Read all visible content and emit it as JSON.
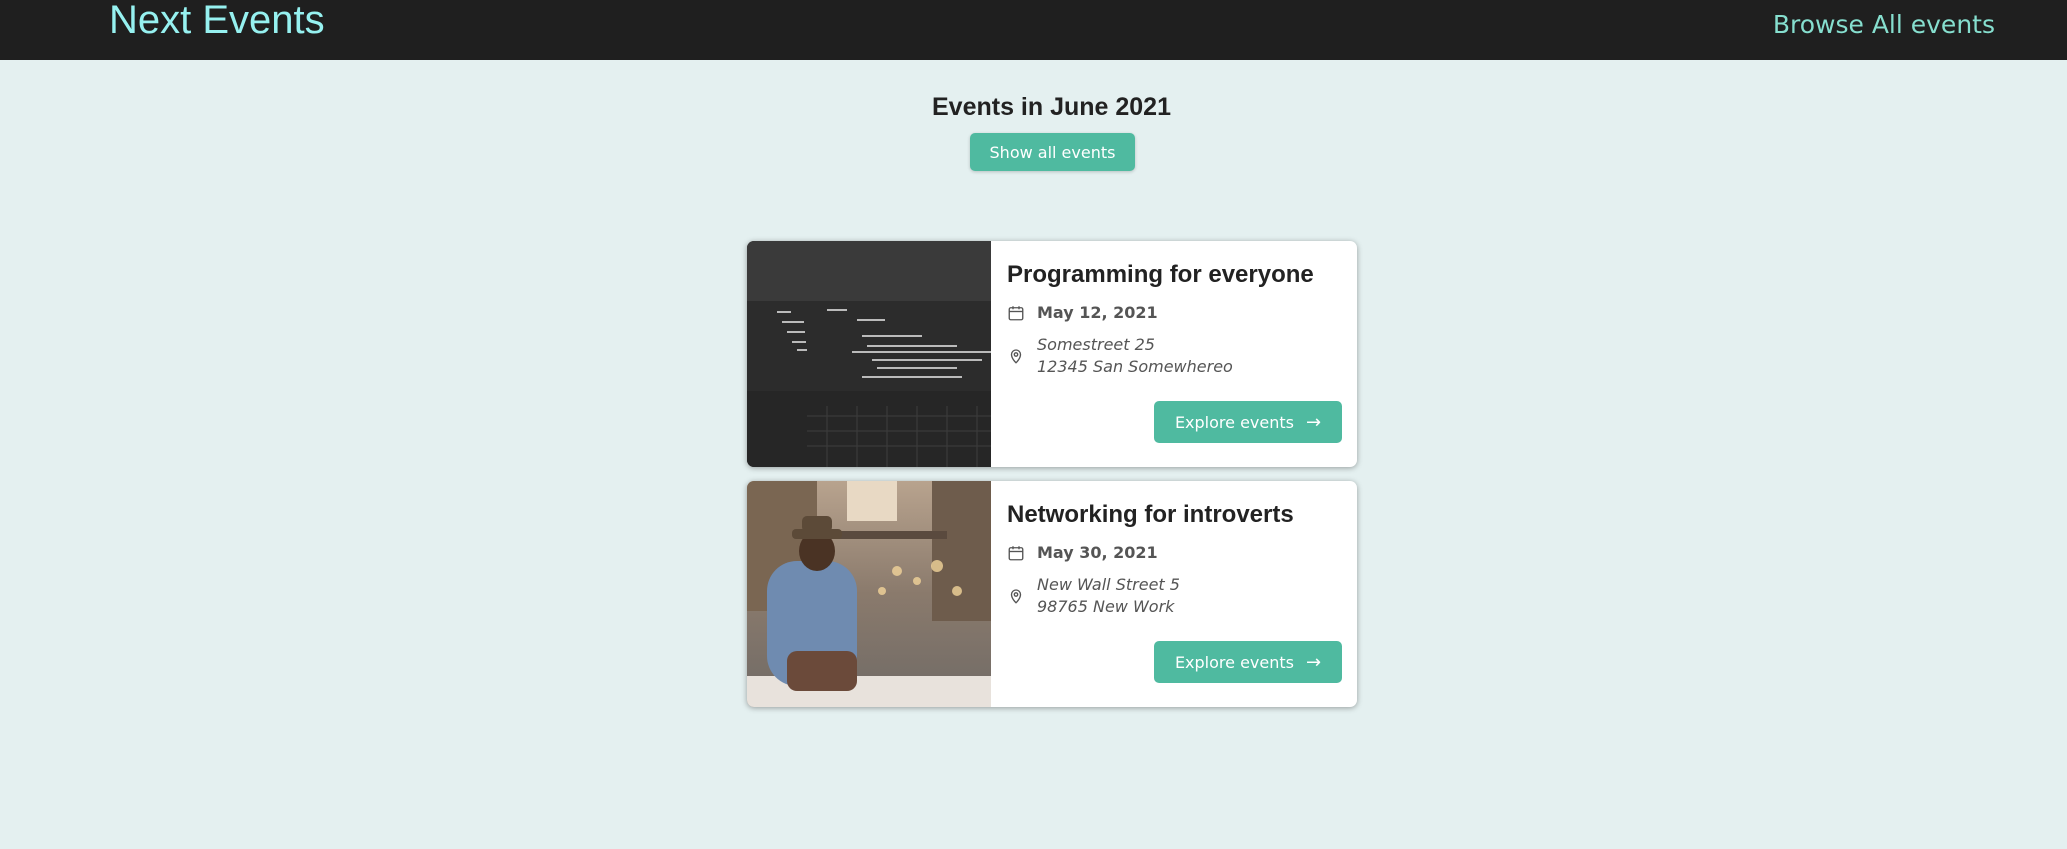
{
  "header": {
    "logo": "Next Events",
    "nav_link": "Browse All events"
  },
  "filter": {
    "title": "Events in June 2021",
    "button": "Show all events"
  },
  "events": [
    {
      "title": "Programming for everyone",
      "date": "May 12, 2021",
      "address_line1": "Somestreet 25",
      "address_line2": "12345 San Somewhereo",
      "button": "Explore events",
      "arrow": "→"
    },
    {
      "title": "Networking for introverts",
      "date": "May 30, 2021",
      "address_line1": "New Wall Street 5",
      "address_line2": "98765 New Work",
      "button": "Explore events",
      "arrow": "→"
    }
  ],
  "colors": {
    "header_bg": "#1f1f1f",
    "logo": "#96f1f0",
    "nav_link": "#86dfcf",
    "accent": "#4fbaa0",
    "page_bg": "#e4f0f0"
  },
  "icons": {
    "date": "calendar-icon",
    "address": "map-pin-icon",
    "button": "arrow-right-icon"
  }
}
